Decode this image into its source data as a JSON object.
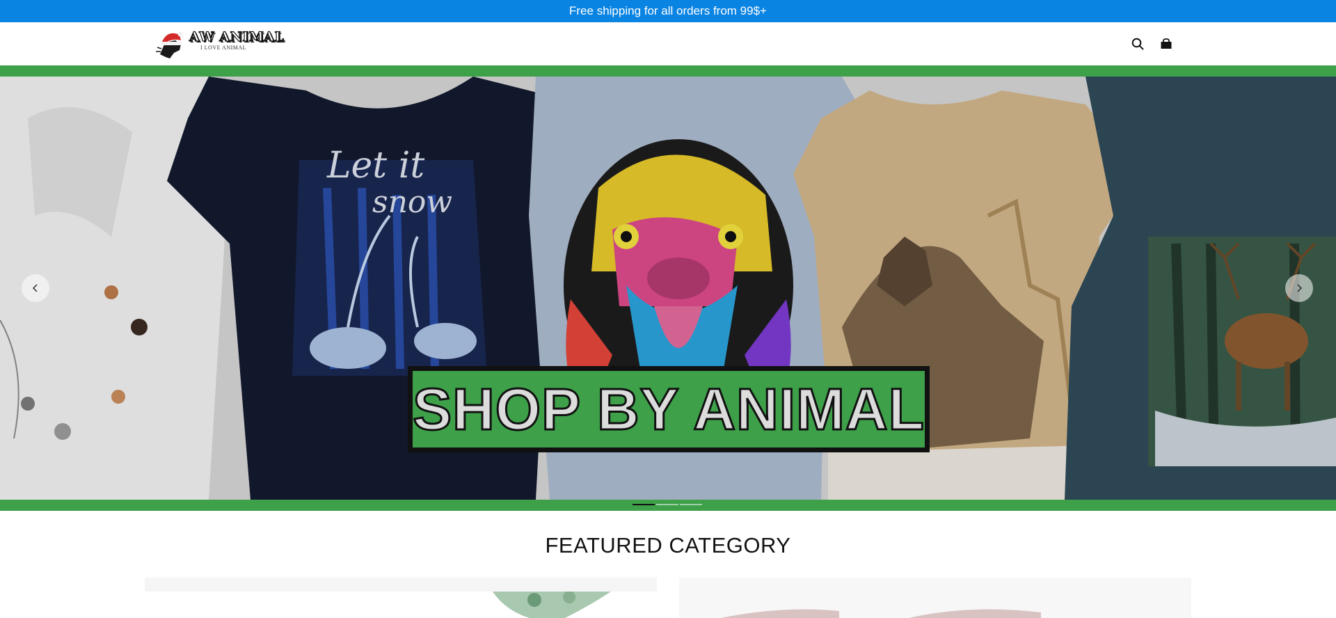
{
  "announcement": {
    "text": "Free shipping for all orders from 99$+"
  },
  "header": {
    "logo": {
      "name": "AW ANIMAL",
      "tagline": "I LOVE ANIMAL"
    },
    "icons": {
      "search": "search-icon",
      "cart": "cart-icon"
    }
  },
  "hero": {
    "banner_text": "SHOP BY ANIMAL",
    "slides_count": 3,
    "active_slide": 1,
    "colors": {
      "banner_green": "#3ea14a",
      "announce_blue": "#0a84e3"
    }
  },
  "featured": {
    "title": "FEATURED CATEGORY"
  }
}
